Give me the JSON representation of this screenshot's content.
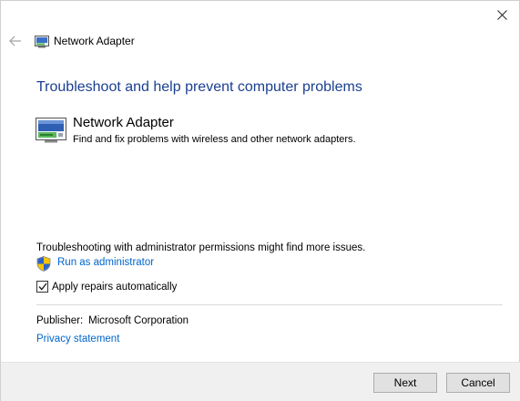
{
  "window": {
    "title": "Network Adapter",
    "close_glyph": "✕",
    "back_glyph": "←"
  },
  "main": {
    "heading": "Troubleshoot and help prevent computer problems",
    "item": {
      "title": "Network Adapter",
      "description": "Find and fix problems with wireless and other network adapters.",
      "icon": "network-adapter-icon"
    },
    "admin_note": "Troubleshooting with administrator permissions might find more issues.",
    "run_as_admin_label": "Run as administrator",
    "apply_repairs": {
      "label": "Apply repairs automatically",
      "checked": true
    },
    "publisher": {
      "label": "Publisher:",
      "value": "Microsoft Corporation"
    },
    "privacy_label": "Privacy statement"
  },
  "footer": {
    "next_label": "Next",
    "cancel_label": "Cancel"
  },
  "colors": {
    "heading": "#1b3f91",
    "link": "#0066cc",
    "footer_bg": "#f0f0f0"
  }
}
